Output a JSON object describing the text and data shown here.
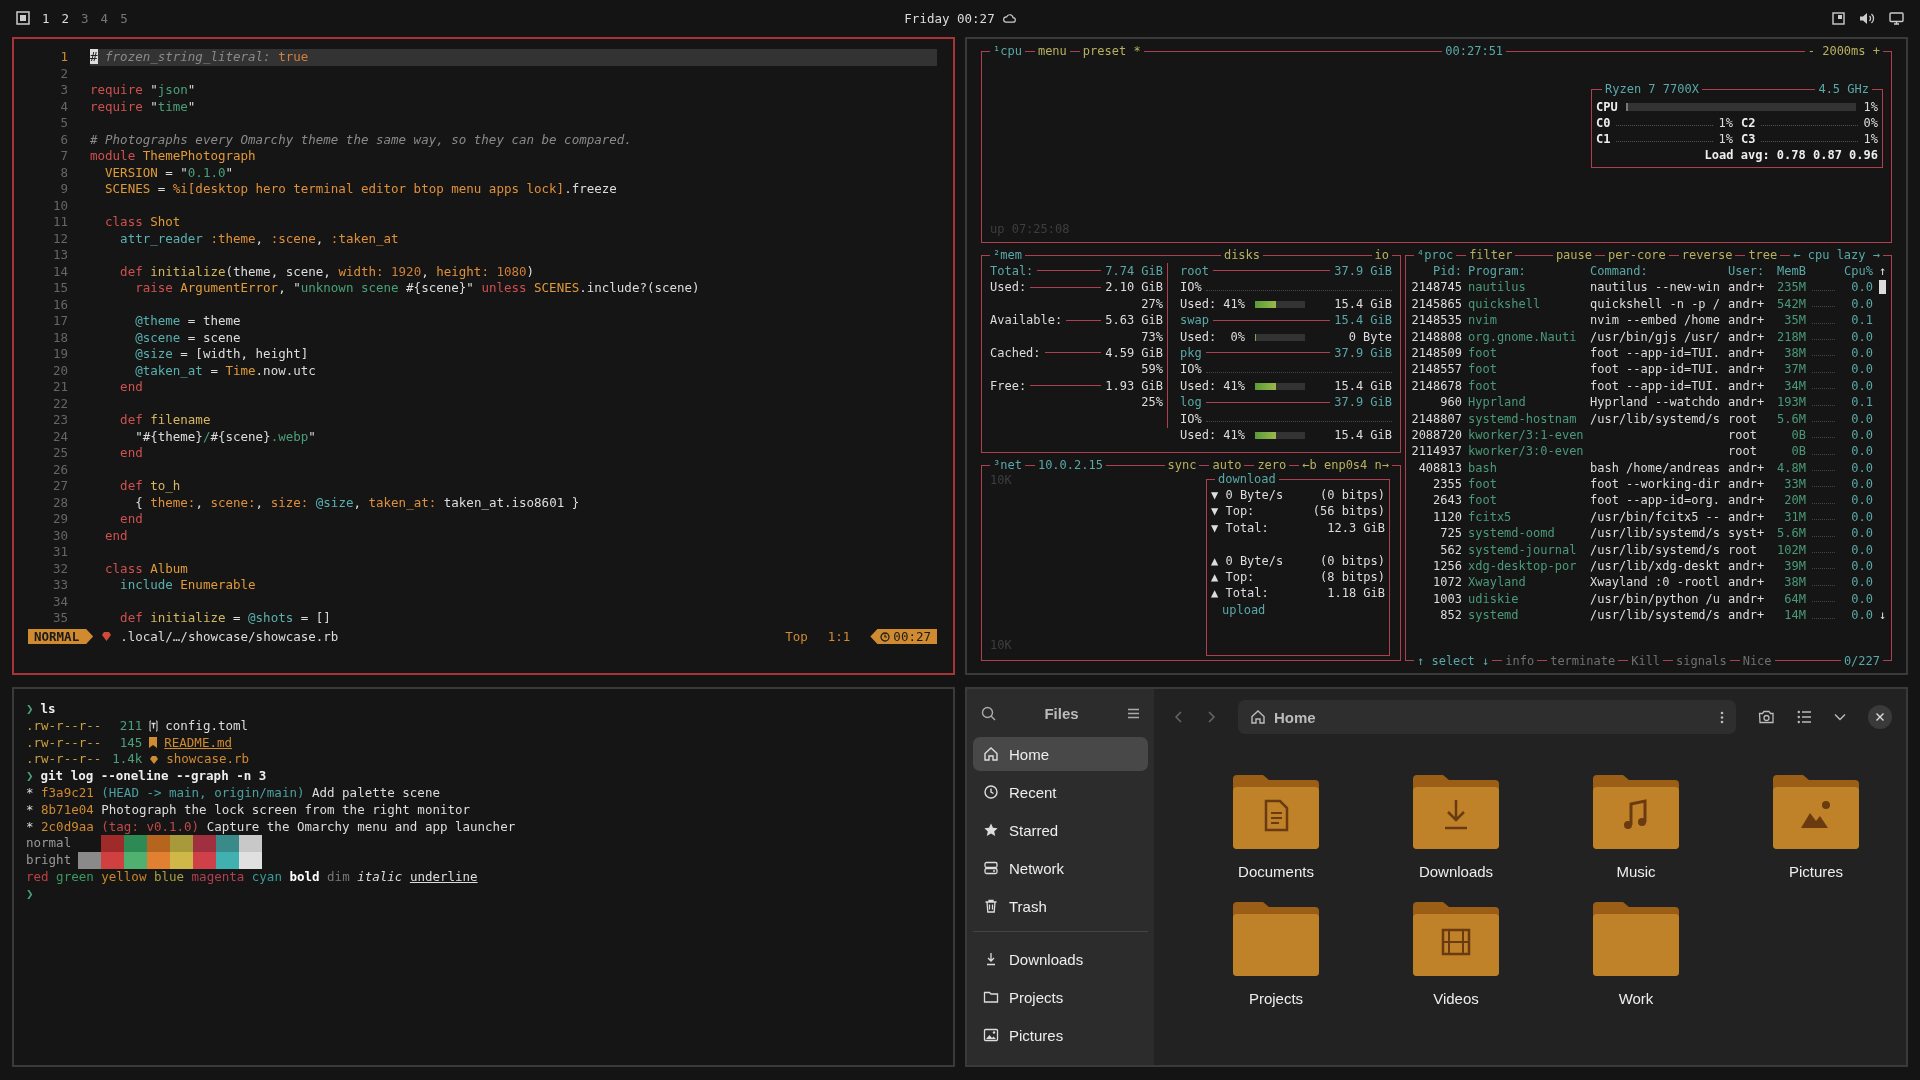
{
  "topbar": {
    "workspaces": [
      {
        "label": "1",
        "occupied": true
      },
      {
        "label": "2",
        "occupied": true
      },
      {
        "label": "3",
        "occupied": false
      },
      {
        "label": "4",
        "occupied": false
      },
      {
        "label": "5",
        "occupied": false
      }
    ],
    "clock": "Friday 00:27"
  },
  "editor": {
    "lines": [
      {
        "number": "1",
        "current": true,
        "tokens": [
          {
            "text": "#",
            "kind": "cursor"
          },
          {
            "text": " frozen_string_literal: ",
            "kind": "comment"
          },
          {
            "text": "true",
            "kind": "num"
          }
        ]
      },
      {
        "number": "2",
        "current": false
      },
      {
        "number": "3",
        "current": false,
        "tokens": [
          {
            "text": "require ",
            "kind": "kw"
          },
          {
            "text": "\"",
            "kind": "plain"
          },
          {
            "text": "json",
            "kind": "str"
          },
          {
            "text": "\"",
            "kind": "plain"
          }
        ]
      },
      {
        "number": "4",
        "current": false,
        "tokens": [
          {
            "text": "require ",
            "kind": "kw"
          },
          {
            "text": "\"",
            "kind": "plain"
          },
          {
            "text": "time",
            "kind": "str"
          },
          {
            "text": "\"",
            "kind": "plain"
          }
        ]
      },
      {
        "number": "5",
        "current": false
      },
      {
        "number": "6",
        "current": false,
        "tokens": [
          {
            "text": "# Photographs every Omarchy theme the same way, so they can be compared.",
            "kind": "comment"
          }
        ]
      },
      {
        "number": "7",
        "current": false,
        "tokens": [
          {
            "text": "module ",
            "kind": "kw"
          },
          {
            "text": "ThemePhotograph",
            "kind": "type"
          }
        ]
      },
      {
        "number": "8",
        "current": false,
        "tokens": [
          {
            "text": "  VERSION",
            "kind": "type"
          },
          {
            "text": " = \"",
            "kind": "plain"
          },
          {
            "text": "0.1.0",
            "kind": "str"
          },
          {
            "text": "\"",
            "kind": "plain"
          }
        ]
      },
      {
        "number": "9",
        "current": false,
        "tokens": [
          {
            "text": "  SCENES",
            "kind": "type"
          },
          {
            "text": " = ",
            "kind": "plain"
          },
          {
            "text": "%i[desktop hero terminal editor btop menu apps lock]",
            "kind": "sym"
          },
          {
            "text": ".freeze",
            "kind": "plain"
          }
        ]
      },
      {
        "number": "10",
        "current": false
      },
      {
        "number": "11",
        "current": false,
        "tokens": [
          {
            "text": "  class ",
            "kind": "kw"
          },
          {
            "text": "Shot",
            "kind": "type"
          }
        ]
      },
      {
        "number": "12",
        "current": false,
        "tokens": [
          {
            "text": "    attr_reader ",
            "kind": "ivar"
          },
          {
            "text": ":theme",
            "kind": "sym"
          },
          {
            "text": ", ",
            "kind": "plain"
          },
          {
            "text": ":scene",
            "kind": "sym"
          },
          {
            "text": ", ",
            "kind": "plain"
          },
          {
            "text": ":taken_at",
            "kind": "sym"
          }
        ]
      },
      {
        "number": "13",
        "current": false
      },
      {
        "number": "14",
        "current": false,
        "tokens": [
          {
            "text": "    def ",
            "kind": "kw"
          },
          {
            "text": "initialize",
            "kind": "fn"
          },
          {
            "text": "(theme, scene, ",
            "kind": "plain"
          },
          {
            "text": "width: ",
            "kind": "sym"
          },
          {
            "text": "1920",
            "kind": "num"
          },
          {
            "text": ", ",
            "kind": "plain"
          },
          {
            "text": "height: ",
            "kind": "sym"
          },
          {
            "text": "1080",
            "kind": "num"
          },
          {
            "text": ")",
            "kind": "plain"
          }
        ]
      },
      {
        "number": "15",
        "current": false,
        "tokens": [
          {
            "text": "      raise ",
            "kind": "kw"
          },
          {
            "text": "ArgumentError",
            "kind": "type"
          },
          {
            "text": ", \"",
            "kind": "plain"
          },
          {
            "text": "unknown scene ",
            "kind": "str"
          },
          {
            "text": "#{scene}",
            "kind": "plain"
          },
          {
            "text": "\" ",
            "kind": "plain"
          },
          {
            "text": "unless ",
            "kind": "kw"
          },
          {
            "text": "SCENES",
            "kind": "type"
          },
          {
            "text": ".include?(scene)",
            "kind": "plain"
          }
        ]
      },
      {
        "number": "16",
        "current": false
      },
      {
        "number": "17",
        "current": false,
        "tokens": [
          {
            "text": "      @theme",
            "kind": "ivar"
          },
          {
            "text": " = theme",
            "kind": "plain"
          }
        ]
      },
      {
        "number": "18",
        "current": false,
        "tokens": [
          {
            "text": "      @scene",
            "kind": "ivar"
          },
          {
            "text": " = scene",
            "kind": "plain"
          }
        ]
      },
      {
        "number": "19",
        "current": false,
        "tokens": [
          {
            "text": "      @size",
            "kind": "ivar"
          },
          {
            "text": " = [width, height]",
            "kind": "plain"
          }
        ]
      },
      {
        "number": "20",
        "current": false,
        "tokens": [
          {
            "text": "      @taken_at",
            "kind": "ivar"
          },
          {
            "text": " = ",
            "kind": "plain"
          },
          {
            "text": "Time",
            "kind": "type"
          },
          {
            "text": ".now.utc",
            "kind": "plain"
          }
        ]
      },
      {
        "number": "21",
        "current": false,
        "tokens": [
          {
            "text": "    end",
            "kind": "kw"
          }
        ]
      },
      {
        "number": "22",
        "current": false
      },
      {
        "number": "23",
        "current": false,
        "tokens": [
          {
            "text": "    def ",
            "kind": "kw"
          },
          {
            "text": "filename",
            "kind": "fn"
          }
        ]
      },
      {
        "number": "24",
        "current": false,
        "tokens": [
          {
            "text": "      \"#{theme}",
            "kind": "plain"
          },
          {
            "text": "/",
            "kind": "str"
          },
          {
            "text": "#{scene}",
            "kind": "plain"
          },
          {
            "text": ".webp",
            "kind": "str"
          },
          {
            "text": "\"",
            "kind": "plain"
          }
        ]
      },
      {
        "number": "25",
        "current": false,
        "tokens": [
          {
            "text": "    end",
            "kind": "kw"
          }
        ]
      },
      {
        "number": "26",
        "current": false
      },
      {
        "number": "27",
        "current": false,
        "tokens": [
          {
            "text": "    def ",
            "kind": "kw"
          },
          {
            "text": "to_h",
            "kind": "fn"
          }
        ]
      },
      {
        "number": "28",
        "current": false,
        "tokens": [
          {
            "text": "      { ",
            "kind": "plain"
          },
          {
            "text": "theme:",
            "kind": "sym"
          },
          {
            "text": ", ",
            "kind": "plain"
          },
          {
            "text": "scene:",
            "kind": "sym"
          },
          {
            "text": ", ",
            "kind": "plain"
          },
          {
            "text": "size: ",
            "kind": "sym"
          },
          {
            "text": "@size",
            "kind": "ivar"
          },
          {
            "text": ", ",
            "kind": "plain"
          },
          {
            "text": "taken_at:",
            "kind": "sym"
          },
          {
            "text": " taken_at.iso8601 }",
            "kind": "plain"
          }
        ]
      },
      {
        "number": "29",
        "current": false,
        "tokens": [
          {
            "text": "    end",
            "kind": "kw"
          }
        ]
      },
      {
        "number": "30",
        "current": false,
        "tokens": [
          {
            "text": "  end",
            "kind": "kw"
          }
        ]
      },
      {
        "number": "31",
        "current": false
      },
      {
        "number": "32",
        "current": false,
        "tokens": [
          {
            "text": "  class ",
            "kind": "kw"
          },
          {
            "text": "Album",
            "kind": "type"
          }
        ]
      },
      {
        "number": "33",
        "current": false,
        "tokens": [
          {
            "text": "    include ",
            "kind": "ivar"
          },
          {
            "text": "Enumerable",
            "kind": "type"
          }
        ]
      },
      {
        "number": "34",
        "current": false
      },
      {
        "number": "35",
        "current": false,
        "tokens": [
          {
            "text": "    def ",
            "kind": "kw"
          },
          {
            "text": "initialize",
            "kind": "fn"
          },
          {
            "text": " = ",
            "kind": "plain"
          },
          {
            "text": "@shots",
            "kind": "ivar"
          },
          {
            "text": " = []",
            "kind": "plain"
          }
        ]
      }
    ],
    "statusline": {
      "mode": "NORMAL",
      "file": ".local/…/showcase/showcase.rb",
      "position": "Top",
      "cursor": "1:1",
      "time": "00:27"
    }
  },
  "btop": {
    "cpu": {
      "title": "¹cpu",
      "options": [
        "menu",
        "preset *"
      ],
      "clock": "00:27:51",
      "interval": "- 2000ms +",
      "uptime": "up 07:25:08",
      "model": "Ryzen 7 7700X",
      "frequency": "4.5 GHz",
      "total": {
        "label": "CPU",
        "level": 0.01,
        "reading": "1%"
      },
      "cores": [
        {
          "label": "C0",
          "reading": "1%"
        },
        {
          "label": "C2",
          "reading": "0%"
        },
        {
          "label": "C1",
          "reading": "1%"
        },
        {
          "label": "C3",
          "reading": "1%"
        }
      ],
      "load": "Load avg: 0.78 0.87 0.96"
    },
    "mem": {
      "title": "²mem",
      "rows": [
        {
          "kind": "total",
          "label": "Total:",
          "value": "7.74 GiB"
        },
        {
          "kind": "stat",
          "label": "Used:",
          "value": "2.10 GiB",
          "percent": "27%"
        },
        {
          "kind": "stat",
          "label": "Available:",
          "value": "5.63 GiB",
          "percent": "73%"
        },
        {
          "kind": "stat",
          "label": "Cached:",
          "value": "4.59 GiB",
          "percent": "59%"
        },
        {
          "kind": "stat",
          "label": "Free:",
          "value": "1.93 GiB",
          "percent": "25%"
        }
      ]
    },
    "disks": {
      "title": "disks",
      "io": "io",
      "items": [
        {
          "name": "root",
          "size": "37.9 GiB",
          "io": "IO%",
          "used": "Used: 41%",
          "level": 0.41,
          "amount": "15.4 GiB"
        },
        {
          "name": "swap",
          "size": "15.4 GiB",
          "used": "Used:  0%",
          "level": 0,
          "amount": "0 Byte"
        },
        {
          "name": "pkg",
          "size": "37.9 GiB",
          "io": "IO%",
          "used": "Used: 41%",
          "level": 0.41,
          "amount": "15.4 GiB"
        },
        {
          "name": "log",
          "size": "37.9 GiB",
          "io": "IO%",
          "used": "Used: 41%",
          "level": 0.41,
          "amount": "15.4 GiB"
        }
      ]
    },
    "net": {
      "title": "³net",
      "address": "10.0.2.15",
      "options": [
        "sync",
        "auto",
        "zero"
      ],
      "interface": "←b enp0s4 n→",
      "scale_top": "10K",
      "scale_bottom": "10K",
      "download_title": "download",
      "upload_title": "upload",
      "download": [
        {
          "label": "▼ 0 Byte/s",
          "value": "(0 bitps)"
        },
        {
          "label": "▼ Top:",
          "value": "(56 bitps)"
        },
        {
          "label": "▼ Total:",
          "value": "12.3 GiB"
        }
      ],
      "upload": [
        {
          "label": "▲ 0 Byte/s",
          "value": "(0 bitps)"
        },
        {
          "label": "▲ Top:",
          "value": "(8 bitps)"
        },
        {
          "label": "▲ Total:",
          "value": "1.18 GiB"
        }
      ]
    },
    "proc": {
      "title": "⁴proc",
      "filter": "filter",
      "options": [
        "pause",
        "per-core",
        "reverse",
        "tree"
      ],
      "sort": "← cpu lazy →",
      "columns": [
        "Pid:",
        "Program:",
        "Command:",
        "User:",
        "MemB",
        "Cpu%"
      ],
      "scroll_up": "↑",
      "scroll_down": "↓",
      "rows": [
        {
          "pid": "2148745",
          "program": "nautilus",
          "command": "nautilus --new-win",
          "user": "andr+",
          "mem": "235M",
          "cpu": "0.0"
        },
        {
          "pid": "2145865",
          "program": "quickshell",
          "command": "quickshell -n -p /",
          "user": "andr+",
          "mem": "542M",
          "cpu": "0.0"
        },
        {
          "pid": "2148535",
          "program": "nvim",
          "command": "nvim --embed /home",
          "user": "andr+",
          "mem": "35M",
          "cpu": "0.1"
        },
        {
          "pid": "2148808",
          "program": "org.gnome.Nauti",
          "command": "/usr/bin/gjs /usr/",
          "user": "andr+",
          "mem": "218M",
          "cpu": "0.0"
        },
        {
          "pid": "2148509",
          "program": "foot",
          "command": "foot --app-id=TUI.",
          "user": "andr+",
          "mem": "38M",
          "cpu": "0.0"
        },
        {
          "pid": "2148557",
          "program": "foot",
          "command": "foot --app-id=TUI.",
          "user": "andr+",
          "mem": "37M",
          "cpu": "0.0"
        },
        {
          "pid": "2148678",
          "program": "foot",
          "command": "foot --app-id=TUI.",
          "user": "andr+",
          "mem": "34M",
          "cpu": "0.0"
        },
        {
          "pid": "960",
          "program": "Hyprland",
          "command": "Hyprland --watchdo",
          "user": "andr+",
          "mem": "193M",
          "cpu": "0.1"
        },
        {
          "pid": "2148807",
          "program": "systemd-hostnam",
          "command": "/usr/lib/systemd/s",
          "user": "root",
          "mem": "5.6M",
          "cpu": "0.0"
        },
        {
          "pid": "2088720",
          "program": "kworker/3:1-even",
          "user": "root",
          "mem": "0B",
          "cpu": "0.0"
        },
        {
          "pid": "2114937",
          "program": "kworker/3:0-even",
          "user": "root",
          "mem": "0B",
          "cpu": "0.0"
        },
        {
          "pid": "408813",
          "program": "bash",
          "command": "bash /home/andreas",
          "user": "andr+",
          "mem": "4.8M",
          "cpu": "0.0"
        },
        {
          "pid": "2355",
          "program": "foot",
          "command": "foot --working-dir",
          "user": "andr+",
          "mem": "33M",
          "cpu": "0.0"
        },
        {
          "pid": "2643",
          "program": "foot",
          "command": "foot --app-id=org.",
          "user": "andr+",
          "mem": "20M",
          "cpu": "0.0"
        },
        {
          "pid": "1120",
          "program": "fcitx5",
          "command": "/usr/bin/fcitx5 --",
          "user": "andr+",
          "mem": "31M",
          "cpu": "0.0"
        },
        {
          "pid": "725",
          "program": "systemd-oomd",
          "command": "/usr/lib/systemd/s",
          "user": "syst+",
          "mem": "5.6M",
          "cpu": "0.0"
        },
        {
          "pid": "562",
          "program": "systemd-journal",
          "command": "/usr/lib/systemd/s",
          "user": "root",
          "mem": "102M",
          "cpu": "0.0"
        },
        {
          "pid": "1256",
          "program": "xdg-desktop-por",
          "command": "/usr/lib/xdg-deskt",
          "user": "andr+",
          "mem": "39M",
          "cpu": "0.0"
        },
        {
          "pid": "1072",
          "program": "Xwayland",
          "command": "Xwayland :0 -rootl",
          "user": "andr+",
          "mem": "38M",
          "cpu": "0.0"
        },
        {
          "pid": "1003",
          "program": "udiskie",
          "command": "/usr/bin/python /u",
          "user": "andr+",
          "mem": "64M",
          "cpu": "0.0"
        },
        {
          "pid": "852",
          "program": "systemd",
          "command": "/usr/lib/systemd/s",
          "user": "andr+",
          "mem": "14M",
          "cpu": "0.0"
        }
      ],
      "footer": [
        "↑ select ↓",
        "info",
        "terminate",
        "Kill",
        "signals",
        "Nice"
      ],
      "count": "0/227"
    }
  },
  "terminal": {
    "lines": [
      {
        "kind": "command",
        "prompt": "❯",
        "command": "ls"
      },
      {
        "kind": "toml_file",
        "perms": ".rw-r--r--",
        "size": "211",
        "name": "config.toml"
      },
      {
        "kind": "markdown_file",
        "perms": ".rw-r--r--",
        "size": "145",
        "name": "README.md"
      },
      {
        "kind": "ruby_file",
        "perms": ".rw-r--r--",
        "size": "1.4k",
        "name": "showcase.rb"
      },
      {
        "kind": "command",
        "prompt": "❯",
        "command": "git log --oneline --graph -n 3"
      },
      {
        "kind": "text",
        "tokens": [
          {
            "text": "* ",
            "kind": "plain"
          },
          {
            "text": "f3a9c21",
            "kind": "hash"
          },
          {
            "text": " (HEAD -> main, origin/main)",
            "kind": "ref"
          },
          {
            "text": " Add palette scene",
            "kind": "plain"
          }
        ]
      },
      {
        "kind": "text",
        "tokens": [
          {
            "text": "* ",
            "kind": "plain"
          },
          {
            "text": "8b71e04",
            "kind": "hash"
          },
          {
            "text": " Photograph the lock screen from the right monitor",
            "kind": "plain"
          }
        ]
      },
      {
        "kind": "text",
        "tokens": [
          {
            "text": "* ",
            "kind": "plain"
          },
          {
            "text": "2c0d9aa",
            "kind": "hash"
          },
          {
            "text": " (tag: v0.1.0)",
            "kind": "tag"
          },
          {
            "text": " Capture the Omarchy menu and app launcher",
            "kind": "plain"
          }
        ]
      },
      {
        "kind": "palette",
        "label": "normal",
        "swatches": [
          {
            "color": "#9e2a2a"
          },
          {
            "color": "#2e8a55"
          },
          {
            "color": "#b5651d"
          },
          {
            "color": "#a89a3a"
          },
          {
            "color": "#a03040"
          },
          {
            "color": "#3a8a8a"
          },
          {
            "color": "#c8c8c8"
          }
        ]
      },
      {
        "kind": "palette",
        "label": "bright",
        "swatches": [
          {
            "color": "#8a8a8a"
          },
          {
            "color": "#d04040"
          },
          {
            "color": "#50b070"
          },
          {
            "color": "#e08030"
          },
          {
            "color": "#d0b848"
          },
          {
            "color": "#d04048"
          },
          {
            "color": "#40b0b0"
          },
          {
            "color": "#e0e0e0"
          }
        ]
      },
      {
        "kind": "text",
        "tokens": [
          {
            "text": "red ",
            "kind": "red"
          },
          {
            "text": "green ",
            "kind": "green"
          },
          {
            "text": "yellow ",
            "kind": "yellow"
          },
          {
            "text": "blue ",
            "kind": "blue"
          },
          {
            "text": "magenta ",
            "kind": "magenta"
          },
          {
            "text": "cyan ",
            "kind": "cyan"
          },
          {
            "text": "bold",
            "kind": "bold"
          },
          {
            "text": " dim ",
            "kind": "dim"
          },
          {
            "text": "italic ",
            "kind": "italic"
          },
          {
            "text": "underline",
            "kind": "underline"
          }
        ]
      },
      {
        "kind": "command",
        "prompt": "❯"
      }
    ]
  },
  "files": {
    "title": "Files",
    "places": [
      {
        "kind": "home",
        "label": "Home",
        "selected": true
      },
      {
        "kind": "recent",
        "label": "Recent",
        "selected": false
      },
      {
        "kind": "starred",
        "label": "Starred",
        "selected": false
      },
      {
        "kind": "network",
        "label": "Network",
        "selected": false
      },
      {
        "kind": "trash",
        "label": "Trash",
        "selected": false
      }
    ],
    "bookmarks": [
      {
        "kind": "download",
        "label": "Downloads",
        "selected": false
      },
      {
        "kind": "folder",
        "label": "Projects",
        "selected": false
      },
      {
        "kind": "picture",
        "label": "Pictures",
        "selected": false
      }
    ],
    "location": "Home",
    "items": [
      {
        "kind": "document",
        "label": "Documents"
      },
      {
        "kind": "download",
        "label": "Downloads"
      },
      {
        "kind": "music",
        "label": "Music"
      },
      {
        "kind": "picture",
        "label": "Pictures"
      },
      {
        "kind": "plain",
        "label": "Projects"
      },
      {
        "kind": "video",
        "label": "Videos"
      },
      {
        "kind": "plain",
        "label": "Work"
      }
    ]
  }
}
